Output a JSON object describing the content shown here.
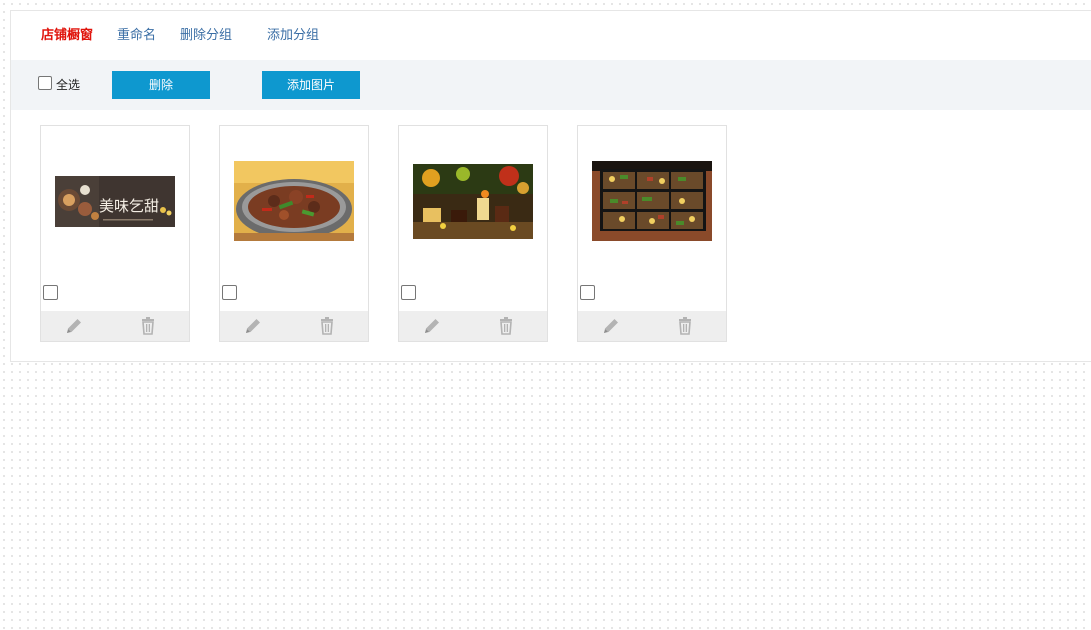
{
  "tabs": [
    {
      "label": "店铺橱窗",
      "active": true
    },
    {
      "label": "重命名",
      "active": false
    },
    {
      "label": "删除分组",
      "active": false
    },
    {
      "label": "添加分组",
      "active": false
    }
  ],
  "toolbar": {
    "select_all_label": "全选",
    "delete_label": "删除",
    "add_image_label": "添加图片"
  },
  "images": [
    {
      "name": "dessert-banner",
      "text": "美味乞甜"
    },
    {
      "name": "stir-fry-dish"
    },
    {
      "name": "dessert-table"
    },
    {
      "name": "bento-boxes"
    }
  ],
  "colors": {
    "accent": "#0e98cf",
    "active_tab": "#e0140c",
    "link": "#3a6ea5",
    "toolbar_bg": "#f2f4f7",
    "card_actions_bg": "#eeeeee",
    "icon": "#b3b3b3"
  },
  "icons": {
    "edit": "pencil-icon",
    "delete": "trash-icon"
  }
}
